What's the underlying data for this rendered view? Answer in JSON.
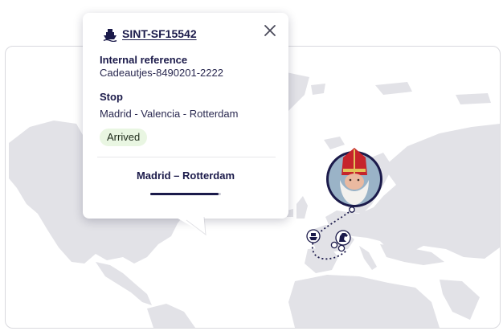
{
  "popup": {
    "shipment_id": "SINT-SF15542",
    "internal_reference_label": "Internal reference",
    "internal_reference_value": "Cadeautjes-8490201-2222",
    "stop_label": "Stop",
    "stop_value": "Madrid - Valencia - Rotterdam",
    "status": "Arrived",
    "route": "Madrid  –  Rotterdam",
    "progress": 0.97,
    "icons": [
      "ship-icon",
      "close-icon"
    ]
  },
  "map": {
    "markers": [
      "ship-marker-icon",
      "horse-marker-icon",
      "avatar-marker"
    ]
  },
  "colors": {
    "land": "#e2e2e7",
    "navy": "#1b1a4a",
    "status_bg": "#e9f6e2"
  }
}
